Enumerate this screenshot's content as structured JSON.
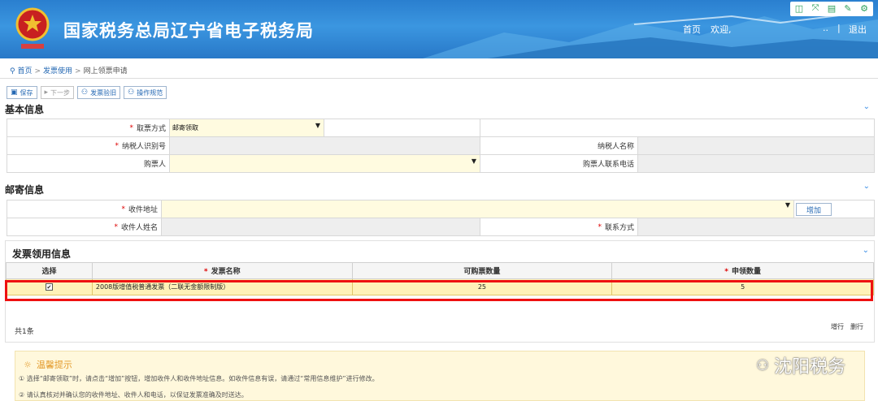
{
  "header": {
    "site_title": "国家税务总局辽宁省电子税务局",
    "home_link": "首页",
    "welcome": "欢迎,",
    "user_placeholder": "..",
    "logout": "退出"
  },
  "breadcrumb": {
    "home": "首页",
    "level1": "发票使用",
    "current": "网上领票申请"
  },
  "toolbar": {
    "save": "保存",
    "next": "下一步",
    "verify": "发票验旧",
    "guide": "操作规范"
  },
  "basic_info": {
    "title": "基本信息",
    "pickup_method_label": "取票方式",
    "pickup_method_value": "邮寄领取",
    "taxpayer_id_label": "纳税人识别号",
    "taxpayer_name_label": "纳税人名称",
    "buyer_label": "购票人",
    "buyer_phone_label": "购票人联系电话"
  },
  "mail_info": {
    "title": "邮寄信息",
    "address_label": "收件地址",
    "add_button": "增加",
    "recipient_label": "收件人姓名",
    "contact_label": "联系方式"
  },
  "invoice_info": {
    "title": "发票领用信息",
    "columns": [
      "选择",
      "发票名称",
      "可购票数量",
      "申领数量"
    ],
    "rows": [
      {
        "checked": true,
        "name": "2008版增值税普通发票（二联无金额限制版）",
        "available": "25",
        "requested": "5"
      }
    ],
    "count": "共1条",
    "add_row": "增行",
    "delete_row": "删行"
  },
  "tips": {
    "title": "温馨提示",
    "line1": "① 选择“邮寄领取”时，请点击“增加”按钮，增加收件人和收件地址信息。如收件信息有误，请通过“常用信息维护”进行修改。",
    "line2": "② 请认真核对并确认您的收件地址、收件人和电话，以保证发票准确及时送达。"
  },
  "watermark": "沈阳税务",
  "colors": {
    "header_blue": "#2a7fcf",
    "link_blue": "#2468b3",
    "highlight_red": "#ee1111",
    "required_red": "#dd0000"
  }
}
